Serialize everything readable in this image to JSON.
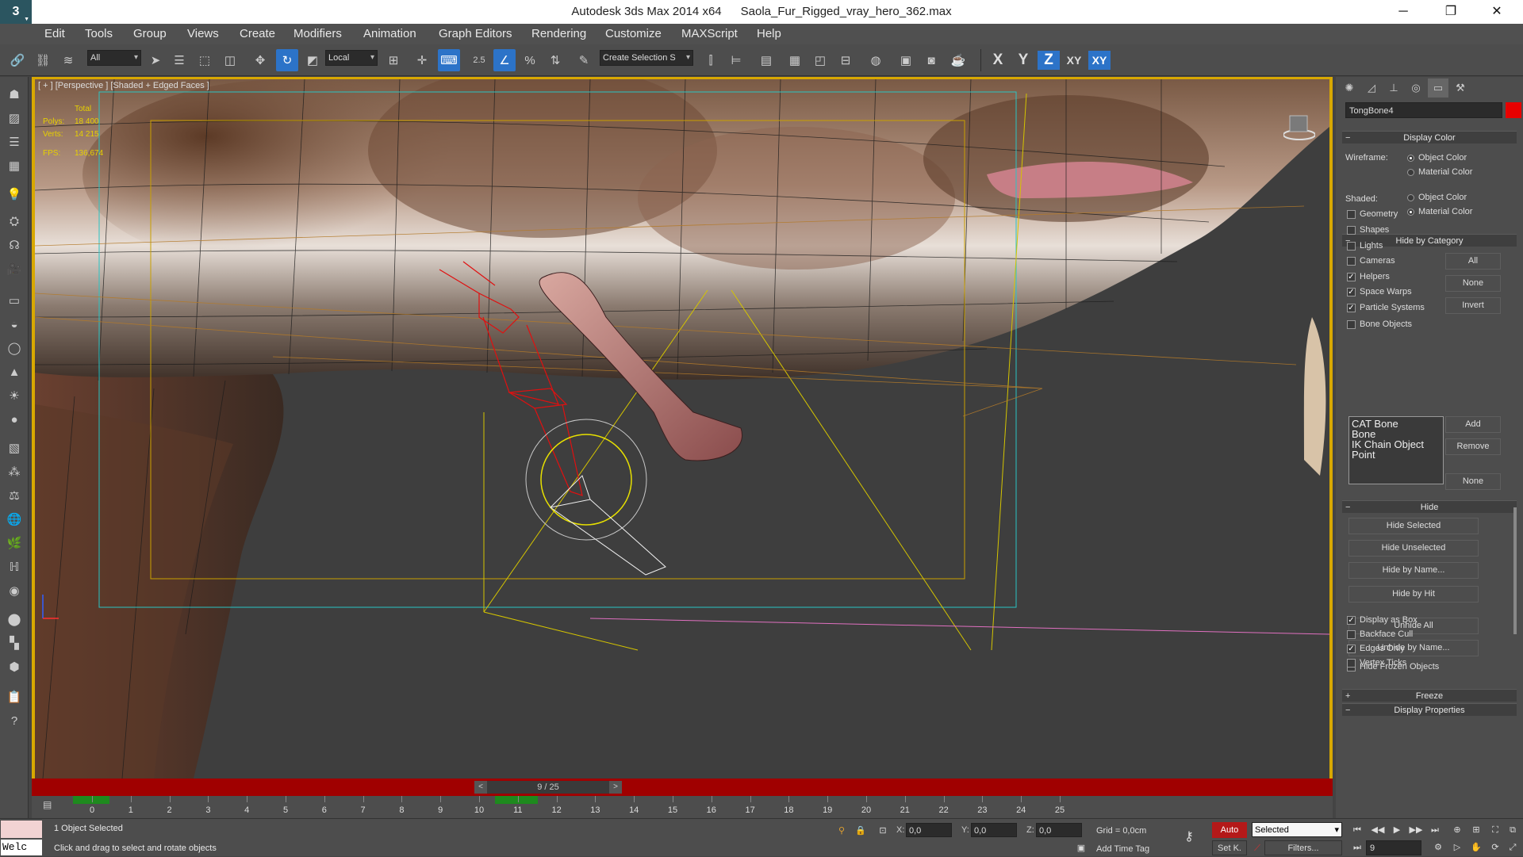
{
  "titlebar": {
    "app_name": "Autodesk 3ds Max  2014 x64",
    "file_name": "Saola_Fur_Rigged_vray_hero_362.max",
    "min": "─",
    "restore": "❐",
    "close": "✕"
  },
  "menu": [
    "Edit",
    "Tools",
    "Group",
    "Views",
    "Create",
    "Modifiers",
    "Animation",
    "Graph Editors",
    "Rendering",
    "Customize",
    "MAXScript",
    "Help"
  ],
  "toolbar": {
    "filter_value": "All",
    "coord_system": "Local",
    "snap_label": "2.5",
    "selection_set_placeholder": "Create Selection S",
    "axis_x": "X",
    "axis_y": "Y",
    "axis_z": "Z",
    "axis_xy": "XY",
    "axis_xy2": "XY",
    "active_color": "#2c73c8"
  },
  "viewport": {
    "label": "[ + ] [Perspective ] [Shaded + Edged Faces ]",
    "stats": {
      "total_label": "Total",
      "polys_label": "Polys:",
      "polys_value": "18 400",
      "verts_label": "Verts:",
      "verts_value": "14 215",
      "fps_label": "FPS:",
      "fps_value": "136,674"
    }
  },
  "time_slider": {
    "position": "9 / 25",
    "prev": "<",
    "next": ">"
  },
  "trackbar": {
    "ticks": [
      "0",
      "1",
      "2",
      "3",
      "4",
      "5",
      "6",
      "7",
      "8",
      "9",
      "10",
      "11",
      "12",
      "13",
      "14",
      "15",
      "16",
      "17",
      "18",
      "19",
      "20",
      "21",
      "22",
      "23",
      "24",
      "25"
    ]
  },
  "status": {
    "selection": "1 Object Selected",
    "prompt": "Click and drag to select and rotate objects",
    "maxscript_text": "Welc",
    "x_label": "X:",
    "x_value": "0,0",
    "y_label": "Y:",
    "y_value": "0,0",
    "z_label": "Z:",
    "z_value": "0,0",
    "grid": "Grid = 0,0cm",
    "add_time_tag": "Add Time Tag",
    "auto": "Auto",
    "set_key": "Set K.",
    "selected": "Selected",
    "filters": "Filters...",
    "frame": "9"
  },
  "command_panel": {
    "object_name": "TongBone4",
    "object_color": "#e80000",
    "display_color": {
      "title": "Display Color",
      "wireframe_label": "Wireframe:",
      "shaded_label": "Shaded:",
      "object_color": "Object Color",
      "material_color": "Material Color"
    },
    "hide_by_category": {
      "title": "Hide by Category",
      "items": [
        {
          "label": "Geometry",
          "checked": false
        },
        {
          "label": "Shapes",
          "checked": false
        },
        {
          "label": "Lights",
          "checked": false
        },
        {
          "label": "Cameras",
          "checked": false
        },
        {
          "label": "Helpers",
          "checked": true
        },
        {
          "label": "Space Warps",
          "checked": true
        },
        {
          "label": "Particle Systems",
          "checked": true
        },
        {
          "label": "Bone Objects",
          "checked": false
        }
      ],
      "all_btn": "All",
      "none_btn": "None",
      "invert_btn": "Invert",
      "list": [
        "CAT Bone",
        "Bone",
        "IK Chain Object",
        "Point"
      ],
      "add_btn": "Add",
      "remove_btn": "Remove",
      "none2_btn": "None"
    },
    "hide": {
      "title": "Hide",
      "hide_selected": "Hide Selected",
      "hide_unselected": "Hide Unselected",
      "hide_by_name": "Hide by Name...",
      "hide_by_hit": "Hide by Hit",
      "unhide_all": "Unhide All",
      "unhide_by_name": "Unhide by Name...",
      "hide_frozen": "Hide Frozen Objects"
    },
    "freeze": {
      "title": "Freeze"
    },
    "display_properties": {
      "title": "Display Properties",
      "items": [
        {
          "label": "Display as Box",
          "checked": true
        },
        {
          "label": "Backface Cull",
          "checked": false
        },
        {
          "label": "Edges Only",
          "checked": true
        },
        {
          "label": "Vertex Ticks",
          "checked": false
        }
      ]
    }
  }
}
